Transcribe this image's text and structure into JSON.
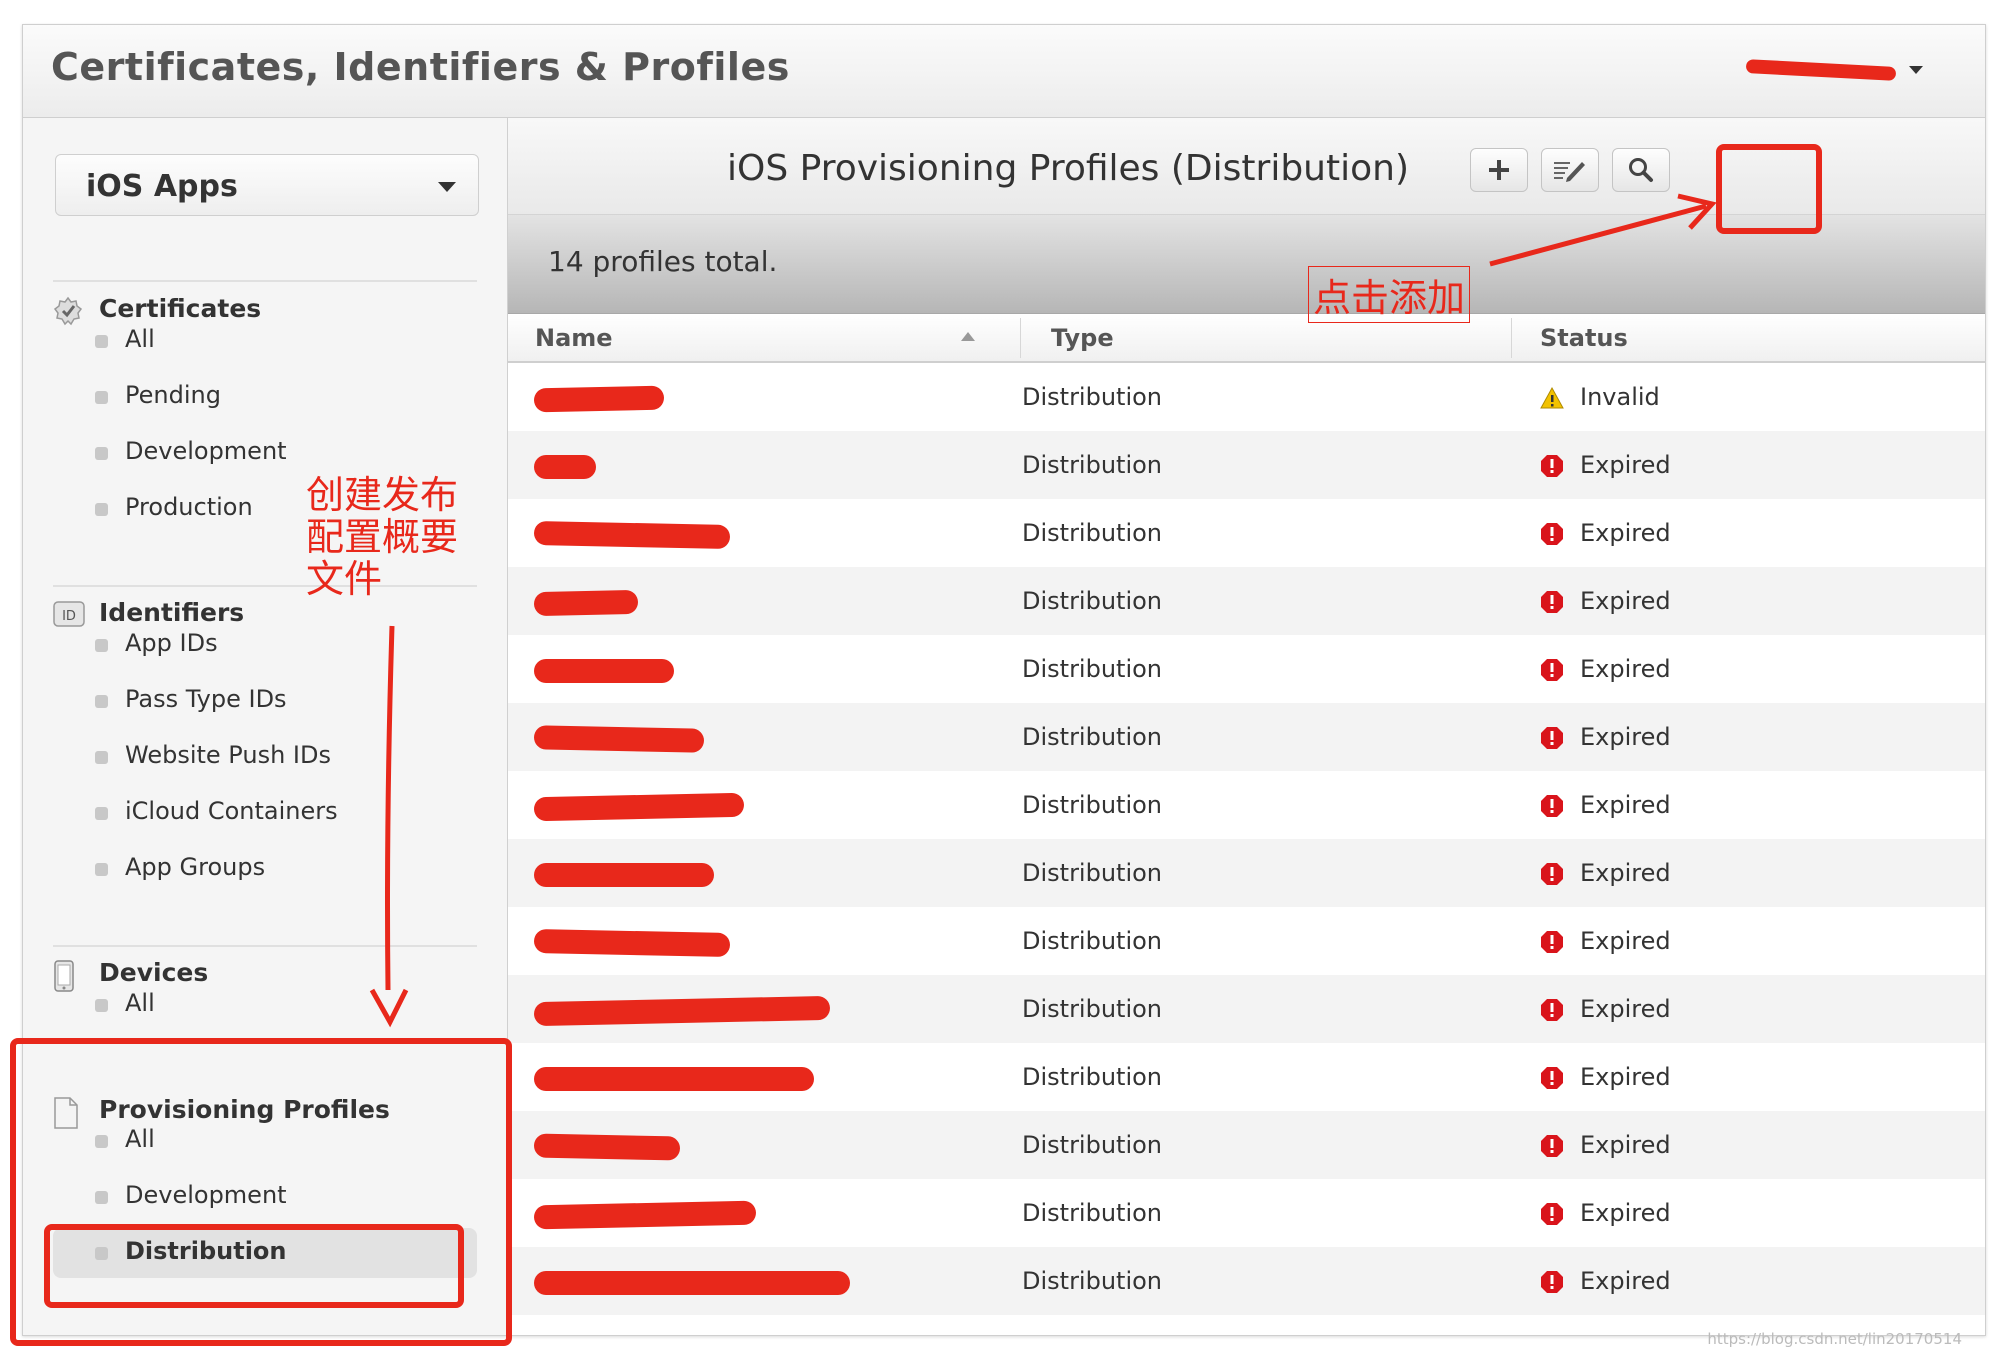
{
  "header": {
    "title": "Certificates, Identifiers & Profiles",
    "user_name": ""
  },
  "sidebar": {
    "platform": "iOS Apps",
    "sections": [
      {
        "label": "Certificates",
        "icon": "certificate-badge-icon",
        "items": [
          "All",
          "Pending",
          "Development",
          "Production"
        ]
      },
      {
        "label": "Identifiers",
        "icon": "id-badge-icon",
        "items": [
          "App IDs",
          "Pass Type IDs",
          "Website Push IDs",
          "iCloud Containers",
          "App Groups"
        ]
      },
      {
        "label": "Devices",
        "icon": "iphone-icon",
        "items": [
          "All"
        ]
      },
      {
        "label": "Provisioning Profiles",
        "icon": "document-icon",
        "items": [
          "All",
          "Development",
          "Distribution"
        ]
      }
    ],
    "active_item": "Distribution"
  },
  "main": {
    "title": "iOS Provisioning Profiles (Distribution)",
    "toolbar": {
      "add_icon": "plus-icon",
      "edit_icon": "edit-icon",
      "search_icon": "search-icon"
    },
    "summary": "14 profiles total.",
    "columns": [
      "Name",
      "Type",
      "Status"
    ],
    "rows": [
      {
        "name": "",
        "type": "Distribution",
        "status": "Invalid",
        "status_icon": "warning-icon"
      },
      {
        "name": "",
        "type": "Distribution",
        "status": "Expired",
        "status_icon": "error-icon"
      },
      {
        "name": "",
        "type": "Distribution",
        "status": "Expired",
        "status_icon": "error-icon"
      },
      {
        "name": "",
        "type": "Distribution",
        "status": "Expired",
        "status_icon": "error-icon"
      },
      {
        "name": "",
        "type": "Distribution",
        "status": "Expired",
        "status_icon": "error-icon"
      },
      {
        "name": "",
        "type": "Distribution",
        "status": "Expired",
        "status_icon": "error-icon"
      },
      {
        "name": "",
        "type": "Distribution",
        "status": "Expired",
        "status_icon": "error-icon"
      },
      {
        "name": "",
        "type": "Distribution",
        "status": "Expired",
        "status_icon": "error-icon"
      },
      {
        "name": "",
        "type": "Distribution",
        "status": "Expired",
        "status_icon": "error-icon"
      },
      {
        "name": "",
        "type": "Distribution",
        "status": "Expired",
        "status_icon": "error-icon"
      },
      {
        "name": "",
        "type": "Distribution",
        "status": "Expired",
        "status_icon": "error-icon"
      },
      {
        "name": "",
        "type": "Distribution",
        "status": "Expired",
        "status_icon": "error-icon"
      },
      {
        "name": "",
        "type": "Distribution",
        "status": "Expired",
        "status_icon": "error-icon"
      },
      {
        "name": "",
        "type": "Distribution",
        "status": "Expired",
        "status_icon": "error-icon"
      }
    ]
  },
  "annotations": {
    "create_note": [
      "创建发布",
      "配置概要",
      "文件"
    ],
    "add_note": "点击添加",
    "color": "#e8281b"
  },
  "watermark": "https://blog.csdn.net/lin20170514"
}
